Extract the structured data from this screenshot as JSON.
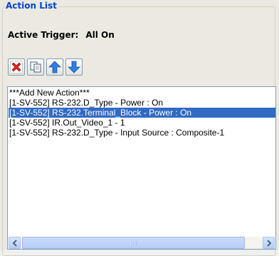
{
  "group": {
    "title": "Action List"
  },
  "trigger": {
    "label": "Active Trigger:",
    "value": "All On"
  },
  "toolbar": {
    "buttons": [
      {
        "name": "delete-action-button",
        "icon": "delete-x-icon"
      },
      {
        "name": "copy-action-button",
        "icon": "copy-icon"
      },
      {
        "name": "move-up-button",
        "icon": "arrow-up-icon"
      },
      {
        "name": "move-down-button",
        "icon": "arrow-down-icon"
      }
    ]
  },
  "list": {
    "items": [
      {
        "text": "***Add New Action***",
        "selected": false
      },
      {
        "text": "[1-SV-552] RS-232.D_Type - Power : On",
        "selected": false
      },
      {
        "text": "[1-SV-552] RS-232.Terminal_Block - Power : On",
        "selected": true
      },
      {
        "text": "[1-SV-552] IR.Out_Video_1 - 1",
        "selected": false
      },
      {
        "text": "[1-SV-552] RS-232.D_Type - Input Source : Composite-1",
        "selected": false
      }
    ]
  },
  "colors": {
    "title": "#0046d5",
    "selection": "#316ac5",
    "delete": "#e02020",
    "arrow": "#2f7fe0"
  }
}
